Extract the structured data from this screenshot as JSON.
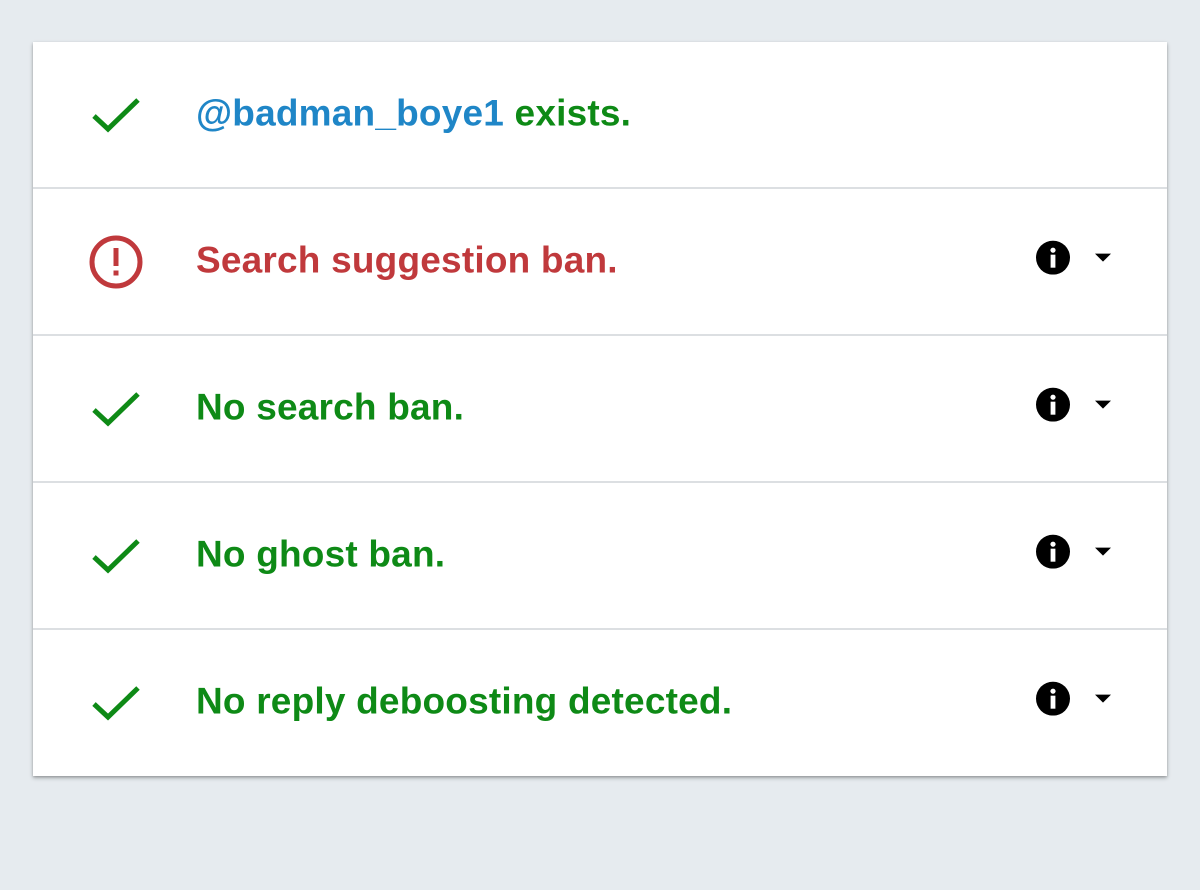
{
  "colors": {
    "success": "#0e8a16",
    "error": "#c0393c",
    "link": "#1f86c7",
    "background": "#e6ebef"
  },
  "rows": [
    {
      "status": "ok",
      "icon": "check-icon",
      "handle": "@badman_boye1",
      "text": " exists.",
      "has_actions": false
    },
    {
      "status": "bad",
      "icon": "alert-circle-icon",
      "text": "Search suggestion ban.",
      "has_actions": true
    },
    {
      "status": "ok",
      "icon": "check-icon",
      "text": "No search ban.",
      "has_actions": true
    },
    {
      "status": "ok",
      "icon": "check-icon",
      "text": "No ghost ban.",
      "has_actions": true
    },
    {
      "status": "ok",
      "icon": "check-icon",
      "text": "No reply deboosting detected.",
      "has_actions": true
    }
  ]
}
